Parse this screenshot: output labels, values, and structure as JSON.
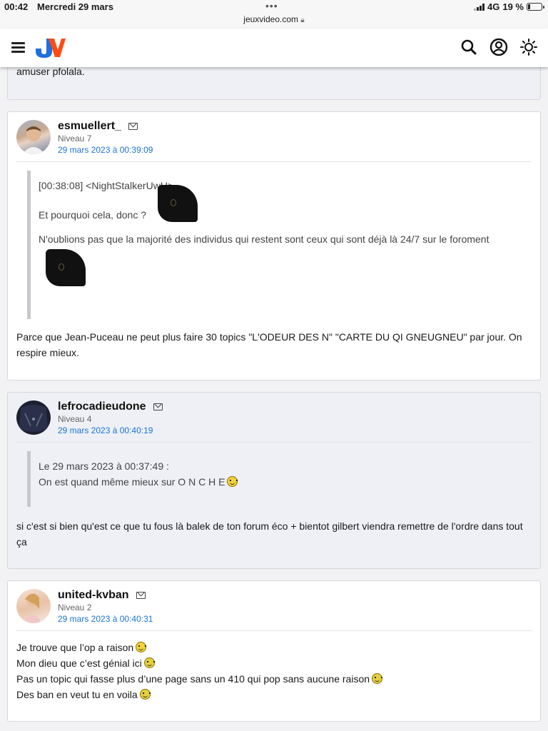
{
  "statusbar": {
    "time": "00:42",
    "date": "Mercredi 29 mars",
    "url": "jeuxvideo.com",
    "network": "4G",
    "battery": "19 %",
    "battery_level": 0.19
  },
  "header": {
    "logo": "JV"
  },
  "previous_post": {
    "text": "amuser pfolala."
  },
  "posts": [
    {
      "author": "esmuellert_",
      "level": "Niveau 7",
      "date": "29 mars 2023 à 00:39:09",
      "quote_line1": "[00:38:08] <NightStalkerUwU>",
      "quote_line2": "Et pourquoi cela, donc ?",
      "quote_line3": "N'oublions pas que la majorité des individus qui restent sont ceux qui sont déjà là 24/7 sur le foroment",
      "message": "Parce que Jean-Puceau ne peut plus faire 30 topics \"L'ODEUR DES N\" \"CARTE DU QI GNEUGNEU\" par jour. On respire mieux."
    },
    {
      "author": "lefrocadieudone",
      "level": "Niveau 4",
      "date": "29 mars 2023 à 00:40:19",
      "quote_line1": "Le 29 mars 2023 à 00:37:49 :",
      "quote_line2": "On est quand même mieux sur O N C H E",
      "message": "si c'est si bien qu'est ce que tu fous là balek de ton forum éco + bientot gilbert viendra remettre de l'ordre dans tout ça"
    },
    {
      "author": "united-kvban",
      "level": "Niveau 2",
      "date": "29 mars 2023 à 00:40:31",
      "lines": [
        "Je trouve que l’op a raison",
        "Mon dieu que c’est génial ici",
        "Pas un topic qui fasse plus d’une page sans un 410 qui pop sans aucune raison",
        "Des ban en veut tu en voila"
      ]
    }
  ]
}
